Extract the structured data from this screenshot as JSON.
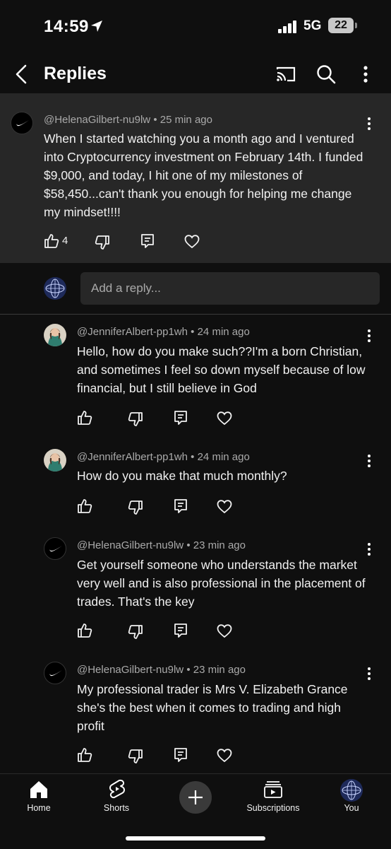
{
  "status_bar": {
    "time": "14:59",
    "network": "5G",
    "battery": "22"
  },
  "header": {
    "title": "Replies"
  },
  "parent_comment": {
    "author": "@HelenaGilbert-nu9lw",
    "age": "25 min ago",
    "text": "When I started watching you a month ago and I ventured into Cryptocurrency investment on February 14th. I funded $9,000, and today, I hit one of my milestones of $58,450...can't thank you enough for helping me change my mindset!!!!",
    "likes": "4"
  },
  "reply_box": {
    "placeholder": "Add a reply..."
  },
  "replies": [
    {
      "author": "@JenniferAlbert-pp1wh",
      "age": "24 min ago",
      "text": "Hello, how do you make such??I'm a born Christian, and sometimes I feel so down myself because of low financial, but I still believe in God"
    },
    {
      "author": "@JenniferAlbert-pp1wh",
      "age": "24 min ago",
      "text": "How do you make that much monthly?"
    },
    {
      "author": "@HelenaGilbert-nu9lw",
      "age": "23 min ago",
      "text": "Get yourself someone who understands the market very well and is also professional in the placement of trades. That's the key"
    },
    {
      "author": "@HelenaGilbert-nu9lw",
      "age": "23 min ago",
      "text": "My professional trader is Mrs V. Elizabeth Grance she's the best when it comes to trading and high profit"
    }
  ],
  "meta_separator": "•",
  "nav": {
    "home": "Home",
    "shorts": "Shorts",
    "subscriptions": "Subscriptions",
    "you": "You"
  },
  "colors": {
    "background": "#0f0f0f",
    "parent_bg": "#272727",
    "meta_text": "#aaaaaa"
  }
}
